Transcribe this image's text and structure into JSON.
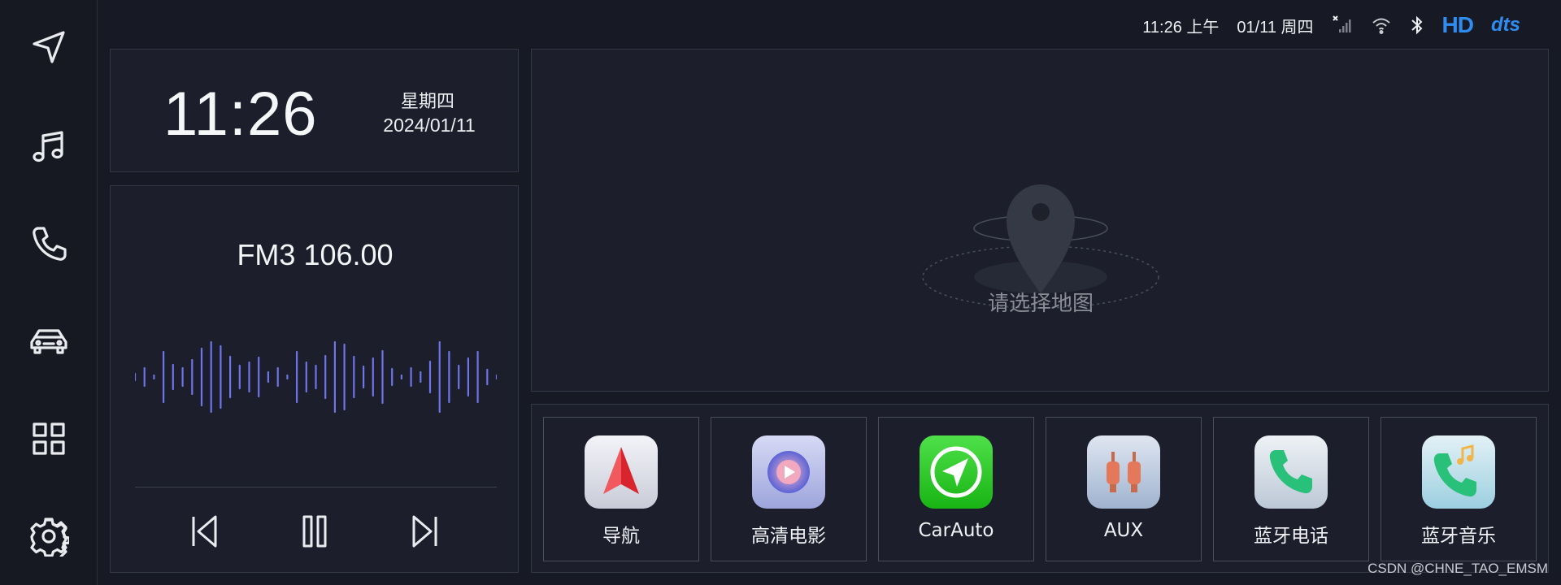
{
  "status_bar": {
    "time": "11:26 上午",
    "date": "01/11 周四",
    "hd_label": "HD",
    "dts_label": "dts"
  },
  "sidebar": {
    "items": [
      {
        "icon": "navigation-icon"
      },
      {
        "icon": "music-icon"
      },
      {
        "icon": "phone-icon"
      },
      {
        "icon": "car-icon"
      },
      {
        "icon": "apps-grid-icon"
      },
      {
        "icon": "settings-gear-icon"
      }
    ]
  },
  "clock_widget": {
    "time": "11:26",
    "weekday": "星期四",
    "date": "2024/01/11"
  },
  "radio_widget": {
    "station": "FM3 106.00",
    "accent_color": "#6f74e8"
  },
  "map_widget": {
    "hint": "请选择地图"
  },
  "apps": [
    {
      "label": "导航",
      "icon": "navigation-app-icon"
    },
    {
      "label": "高清电影",
      "icon": "movie-app-icon"
    },
    {
      "label": "CarAuto",
      "icon": "carauto-app-icon"
    },
    {
      "label": "AUX",
      "icon": "aux-app-icon"
    },
    {
      "label": "蓝牙电话",
      "icon": "bluetooth-phone-app-icon"
    },
    {
      "label": "蓝牙音乐",
      "icon": "bluetooth-music-app-icon"
    }
  ],
  "watermark": "CSDN @CHNE_TAO_EMSM"
}
